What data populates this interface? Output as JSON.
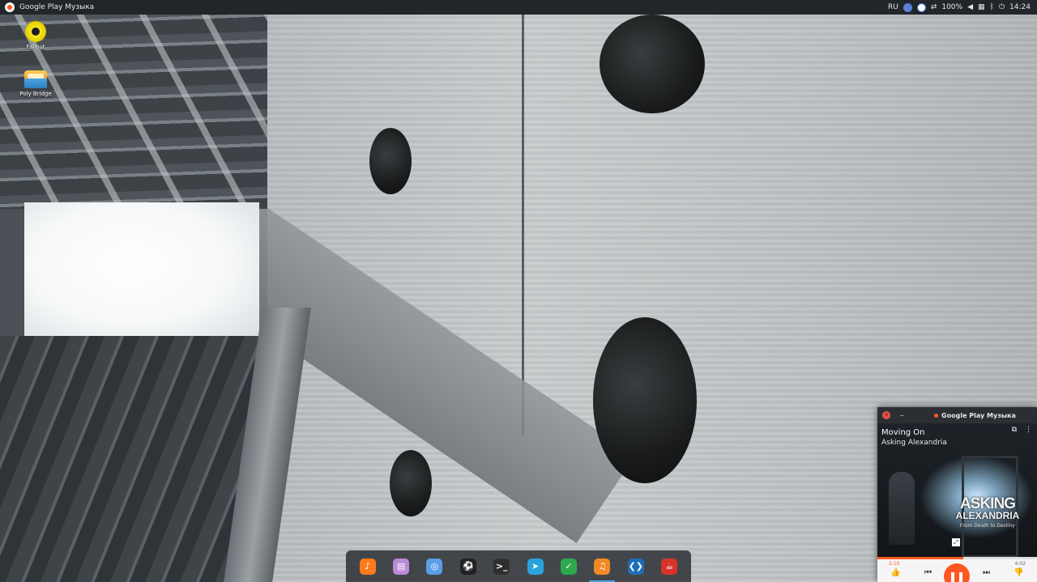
{
  "top_panel": {
    "app_title": "Google Play Музыка",
    "language": "RU",
    "battery": "100%",
    "clock": "14:24",
    "tray_icons": [
      "app-indicator-icon",
      "chat-icon",
      "link-icon",
      "volume-icon",
      "clipboard-icon",
      "bluetooth-icon",
      "power-icon"
    ]
  },
  "desktop": {
    "icons": [
      {
        "label": "Fallout",
        "icon": "fallout-icon"
      },
      {
        "label": "Poly Bridge",
        "icon": "bridge-icon"
      }
    ]
  },
  "dock": {
    "items": [
      {
        "name": "google-play-music",
        "color": "#ff7a1a",
        "glyph": "♪"
      },
      {
        "name": "files",
        "color": "#b98ad6",
        "glyph": "▤"
      },
      {
        "name": "browser",
        "color": "#5a9ee8",
        "glyph": "◎"
      },
      {
        "name": "soccer-app",
        "color": "#222222",
        "glyph": "⚽"
      },
      {
        "name": "terminal",
        "color": "#2f2f2f",
        "glyph": ">_"
      },
      {
        "name": "telegram",
        "color": "#2aa3dc",
        "glyph": "➤"
      },
      {
        "name": "vpn-shield",
        "color": "#2ea84f",
        "glyph": "✓"
      },
      {
        "name": "headphones",
        "color": "#f08a24",
        "glyph": "♫"
      },
      {
        "name": "vscode",
        "color": "#1e6fb8",
        "glyph": "❮❯"
      },
      {
        "name": "java",
        "color": "#d9322b",
        "glyph": "☕"
      }
    ],
    "active_index": 7
  },
  "player": {
    "window_title": "Google Play Музыка",
    "track_title": "Moving On",
    "artist": "Asking Alexandria",
    "band_logo_line1": "ASKING",
    "band_logo_line2": "ALEXANDRIA",
    "album_title": "From Death to Destiny",
    "time_current": "2:10",
    "time_total": "4:02",
    "progress_fraction": 0.537,
    "accent_color": "#ff5722"
  }
}
